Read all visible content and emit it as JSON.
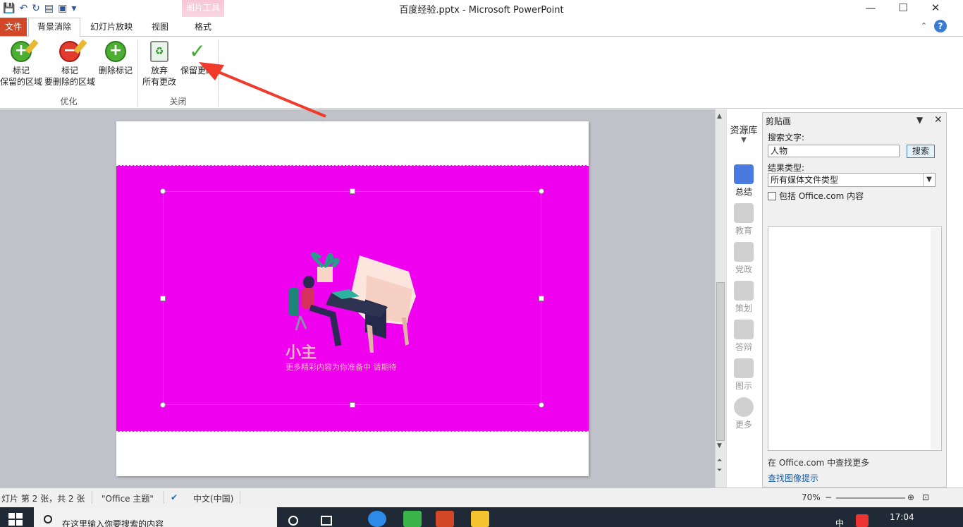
{
  "window": {
    "title": "百度经验.pptx - Microsoft PowerPoint",
    "context_group": "图片工具"
  },
  "tabs": {
    "file": "文件",
    "background_removal": "背景消除",
    "slideshow": "幻灯片放映",
    "view": "视图",
    "format": "格式"
  },
  "ribbon": {
    "mark_keep_line1": "标记",
    "mark_keep_line2": "保留的区域",
    "mark_remove_line1": "标记",
    "mark_remove_line2": "要删除的区域",
    "delete_mark": "删除标记",
    "discard_line1": "放弃",
    "discard_line2": "所有更改",
    "keep_changes": "保留更改",
    "group_refine": "优化",
    "group_close": "关闭"
  },
  "slide": {
    "watermark_title": "小主",
    "watermark_sub": "更多精彩内容为你准备中  请期待"
  },
  "resource_library": {
    "title": "资源库",
    "items": [
      "总结",
      "教育",
      "党政",
      "策划",
      "答辩",
      "图示",
      "更多"
    ]
  },
  "clipart": {
    "title": "剪贴画",
    "search_label": "搜索文字:",
    "search_value": "人物",
    "search_button": "搜索",
    "type_label": "结果类型:",
    "type_value": "所有媒体文件类型",
    "include_office": "包括 Office.com 内容",
    "footer_organize": "在 Office.com 中查找更多",
    "footer_tips": "查找图像提示"
  },
  "statusbar": {
    "slide_info": "灯片 第 2 张，共 2 张",
    "theme": "\"Office 主题\"",
    "language": "中文(中国)",
    "zoom": "70%"
  },
  "taskbar": {
    "search_placeholder": "在这里输入你要搜索的内容",
    "time": "17:04",
    "ime": "中"
  },
  "colors": {
    "file_tab": "#d24726",
    "slide_background_removed": "#ef00ef",
    "annotation_arrow": "#f03a2a"
  }
}
